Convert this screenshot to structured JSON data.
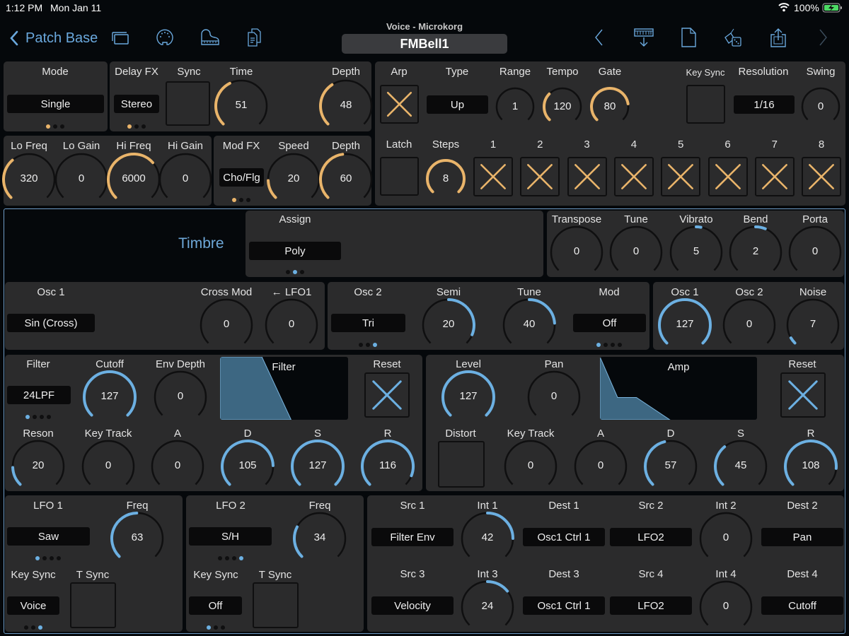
{
  "status_bar": {
    "time": "1:12 PM",
    "date": "Mon Jan 11",
    "battery": "100%",
    "wifi_icon": "wifi-icon",
    "battery_icon": "battery-charging-icon"
  },
  "nav": {
    "back_label": "Patch Base",
    "subtitle": "Voice - Microkorg",
    "patch_name": "FMBell1",
    "left_icons": [
      "windows-icon",
      "midi-port-icon",
      "piano-icon",
      "documents-icon"
    ],
    "right_icons": [
      "chevron-left-icon",
      "keyboard-download-icon",
      "new-document-icon",
      "dice-icon",
      "share-icon",
      "chevron-right-icon"
    ]
  },
  "accent": {
    "gold": "#e9b46a",
    "blue": "#6cb0e2",
    "track": "#0f0f10"
  },
  "mode": {
    "label": "Mode",
    "value": "Single",
    "dots": 3,
    "active_dot": 0
  },
  "delay": {
    "fx_label": "Delay FX",
    "fx_value": "Stereo",
    "dots": 3,
    "active_dot": 0,
    "sync_label": "Sync",
    "sync_on": false,
    "time_label": "Time",
    "time": 51,
    "depth_label": "Depth",
    "depth": 48
  },
  "eq": {
    "lo_freq_label": "Lo Freq",
    "lo_freq": "320",
    "lo_freq_frac": 0.35,
    "lo_gain_label": "Lo Gain",
    "lo_gain": "0",
    "hi_freq_label": "Hi Freq",
    "hi_freq": "6000",
    "hi_freq_frac": 0.68,
    "hi_gain_label": "Hi Gain",
    "hi_gain": "0"
  },
  "modfx": {
    "label": "Mod FX",
    "value": "Cho/Flg",
    "dots": 3,
    "active_dot": 0,
    "speed_label": "Speed",
    "speed": 20,
    "depth_label": "Depth",
    "depth": 60
  },
  "arp": {
    "arp_label": "Arp",
    "arp_on": true,
    "type_label": "Type",
    "type": "Up",
    "range_label": "Range",
    "range": "1",
    "range_frac": 0,
    "tempo_label": "Tempo",
    "tempo": "120",
    "tempo_frac": 0.33,
    "gate_label": "Gate",
    "gate": "80",
    "gate_frac": 0.8,
    "keysync_label": "Key Sync",
    "keysync_on": false,
    "resolution_label": "Resolution",
    "resolution": "1/16",
    "swing_label": "Swing",
    "swing": "0",
    "latch_label": "Latch",
    "latch_on": false,
    "steps_label": "Steps",
    "steps": "8",
    "steps_frac": 1.0,
    "step_buttons": [
      {
        "label": "1",
        "on": true
      },
      {
        "label": "2",
        "on": true
      },
      {
        "label": "3",
        "on": true
      },
      {
        "label": "4",
        "on": true
      },
      {
        "label": "5",
        "on": true
      },
      {
        "label": "6",
        "on": true
      },
      {
        "label": "7",
        "on": true
      },
      {
        "label": "8",
        "on": true
      }
    ]
  },
  "timbre": {
    "title": "Timbre",
    "assign_label": "Assign",
    "assign": "Poly",
    "assign_dots": 3,
    "assign_active": 1,
    "transpose_label": "Transpose",
    "transpose": 0,
    "tune_label": "Tune",
    "tune": 0,
    "vibrato_label": "Vibrato",
    "vibrato": 5,
    "bend_label": "Bend",
    "bend": 2,
    "porta_label": "Porta",
    "porta": 0
  },
  "osc1": {
    "label": "Osc 1",
    "wave": "Sin (Cross)",
    "crossmod_label": "Cross Mod",
    "crossmod": 0,
    "lfo1_label": "← LFO1",
    "lfo1": 0
  },
  "osc2": {
    "label": "Osc 2",
    "wave": "Tri",
    "dots": 3,
    "active_dot": 2,
    "semi_label": "Semi",
    "semi": 20,
    "tune_label": "Tune",
    "tune": 40,
    "mod_label": "Mod",
    "mod": "Off",
    "mod_dots": 4,
    "mod_active": 0
  },
  "mixer": {
    "osc1_label": "Osc 1",
    "osc1": 127,
    "osc2_label": "Osc 2",
    "osc2": 0,
    "noise_label": "Noise",
    "noise": 7
  },
  "filter": {
    "type_label": "Filter",
    "type": "24LPF",
    "dots": 4,
    "active_dot": 0,
    "cutoff_label": "Cutoff",
    "cutoff": 127,
    "envdepth_label": "Env Depth",
    "envdepth": 0,
    "graph_label": "Filter",
    "reset_label": "Reset",
    "reson_label": "Reson",
    "reson": 20,
    "keytrack_label": "Key Track",
    "keytrack": 0,
    "a_label": "A",
    "a": 0,
    "d_label": "D",
    "d": 105,
    "s_label": "S",
    "s": 127,
    "r_label": "R",
    "r": 116
  },
  "amp": {
    "level_label": "Level",
    "level": 127,
    "pan_label": "Pan",
    "pan": 0,
    "graph_label": "Amp",
    "reset_label": "Reset",
    "distort_label": "Distort",
    "distort_on": false,
    "keytrack_label": "Key Track",
    "keytrack": 0,
    "a_label": "A",
    "a": 0,
    "d_label": "D",
    "d": 57,
    "s_label": "S",
    "s": 45,
    "r_label": "R",
    "r": 108
  },
  "lfo1": {
    "label": "LFO 1",
    "wave": "Saw",
    "dots": 4,
    "active_dot": 0,
    "freq_label": "Freq",
    "freq": 63,
    "keysync_label": "Key Sync",
    "keysync": "Voice",
    "ks_dots": 3,
    "ks_active": 2,
    "tsync_label": "T Sync",
    "tsync_on": false
  },
  "lfo2": {
    "label": "LFO 2",
    "wave": "S/H",
    "dots": 4,
    "active_dot": 3,
    "freq_label": "Freq",
    "freq": 34,
    "keysync_label": "Key Sync",
    "keysync": "Off",
    "ks_dots": 3,
    "ks_active": 0,
    "tsync_label": "T Sync",
    "tsync_on": false
  },
  "patch": {
    "src1_label": "Src 1",
    "src1": "Filter Env",
    "int1_label": "Int 1",
    "int1": 42,
    "dest1_label": "Dest 1",
    "dest1": "Osc1 Ctrl 1",
    "src2_label": "Src 2",
    "src2": "LFO2",
    "int2_label": "Int 2",
    "int2": 0,
    "dest2_label": "Dest 2",
    "dest2": "Pan",
    "src3_label": "Src 3",
    "src3": "Velocity",
    "int3_label": "Int 3",
    "int3": 24,
    "dest3_label": "Dest 3",
    "dest3": "Osc1 Ctrl 1",
    "src4_label": "Src 4",
    "src4": "LFO2",
    "int4_label": "Int 4",
    "int4": 0,
    "dest4_label": "Dest 4",
    "dest4": "Cutoff"
  }
}
